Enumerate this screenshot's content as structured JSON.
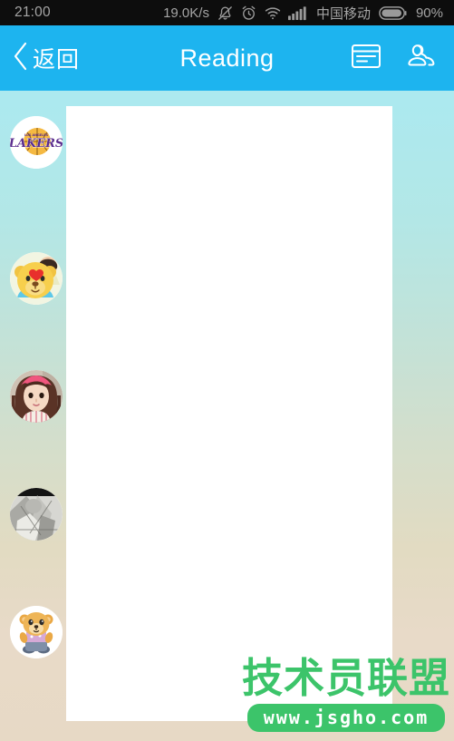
{
  "status_bar": {
    "time": "21:00",
    "net_speed": "19.0K/s",
    "carrier": "中国移动",
    "battery_percent": "90%",
    "icons": [
      "bell-muted-icon",
      "alarm-clock-icon",
      "wifi-icon",
      "cellular-signal-icon",
      "battery-icon"
    ]
  },
  "header": {
    "back_label": "返回",
    "title": "Reading",
    "accent_color": "#1db4ef",
    "actions": [
      {
        "name": "list-view-icon"
      },
      {
        "name": "contacts-icon"
      }
    ]
  },
  "sidebar": {
    "avatars": [
      {
        "name": "avatar-lakers",
        "alt": "Lakers logo avatar"
      },
      {
        "name": "avatar-yellow-bear",
        "alt": "Yellow bear with heart avatar"
      },
      {
        "name": "avatar-girl-photo",
        "alt": "Girl photo avatar"
      },
      {
        "name": "avatar-grayscale-photo",
        "alt": "Grayscale photo avatar"
      },
      {
        "name": "avatar-cartoon-bear",
        "alt": "Cartoon bear avatar"
      }
    ]
  },
  "content": {
    "panel_color": "#ffffff",
    "body_text": ""
  },
  "watermark": {
    "title": "技术员联盟",
    "url": "www.jsgho.com",
    "color": "#3cc46a"
  },
  "background": {
    "gradient_top": "#ace9ef",
    "gradient_bottom": "#e7d9c5"
  }
}
